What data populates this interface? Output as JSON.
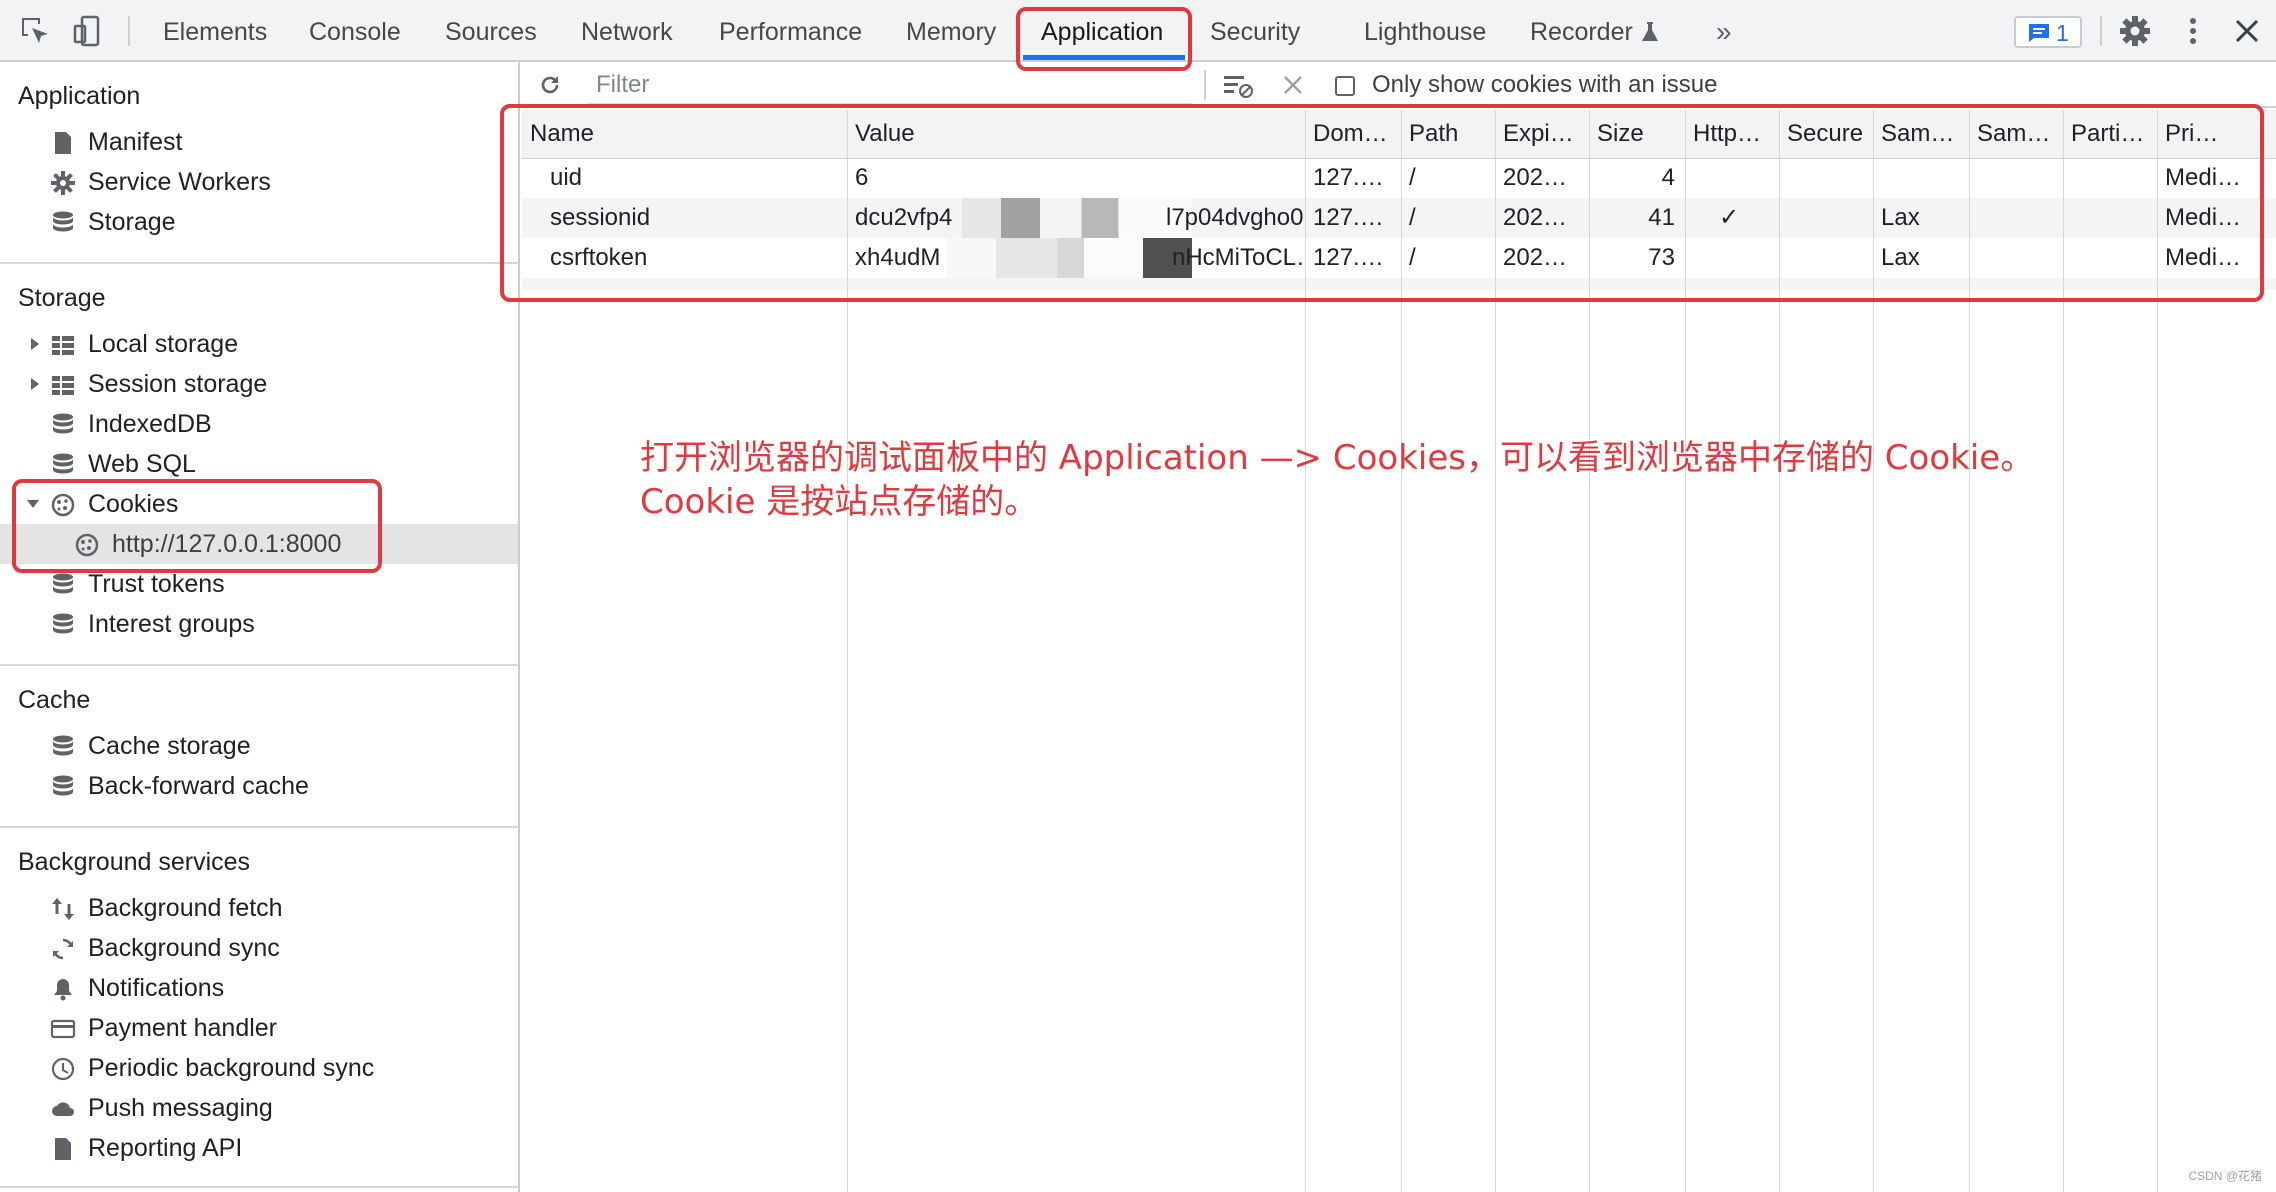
{
  "devtools": {
    "tabs": [
      "Elements",
      "Console",
      "Sources",
      "Network",
      "Performance",
      "Memory",
      "Application",
      "Security",
      "Lighthouse",
      "Recorder"
    ],
    "active_tab": "Application",
    "more_tabs_glyph": "»",
    "issues_count": "1",
    "icons": [
      "inspect-element-icon",
      "device-toolbar-icon",
      "recorder-flask-icon",
      "issues-message-icon",
      "settings-gear-icon",
      "more-vert-icon",
      "close-icon"
    ]
  },
  "sidebar": {
    "application": {
      "title": "Application",
      "items": [
        {
          "label": "Manifest",
          "icon": "document-icon"
        },
        {
          "label": "Service Workers",
          "icon": "gear-icon"
        },
        {
          "label": "Storage",
          "icon": "database-icon"
        }
      ]
    },
    "storage": {
      "title": "Storage",
      "items": [
        {
          "label": "Local storage",
          "icon": "table-grid-icon"
        },
        {
          "label": "Session storage",
          "icon": "table-grid-icon"
        },
        {
          "label": "IndexedDB",
          "icon": "database-icon"
        },
        {
          "label": "Web SQL",
          "icon": "database-icon"
        },
        {
          "label": "Cookies",
          "icon": "cookie-icon"
        },
        {
          "label": "http://127.0.0.1:8000",
          "icon": "cookie-icon"
        },
        {
          "label": "Trust tokens",
          "icon": "database-icon"
        },
        {
          "label": "Interest groups",
          "icon": "database-icon"
        }
      ]
    },
    "cache": {
      "title": "Cache",
      "items": [
        {
          "label": "Cache storage",
          "icon": "database-icon"
        },
        {
          "label": "Back-forward cache",
          "icon": "database-icon"
        }
      ]
    },
    "background": {
      "title": "Background services",
      "items": [
        {
          "label": "Background fetch",
          "icon": "up-down-arrows-icon"
        },
        {
          "label": "Background sync",
          "icon": "sync-icon"
        },
        {
          "label": "Notifications",
          "icon": "bell-icon"
        },
        {
          "label": "Payment handler",
          "icon": "card-icon"
        },
        {
          "label": "Periodic background sync",
          "icon": "clock-icon"
        },
        {
          "label": "Push messaging",
          "icon": "cloud-icon"
        },
        {
          "label": "Reporting API",
          "icon": "document-icon"
        }
      ]
    }
  },
  "toolbar": {
    "filter_placeholder": "Filter",
    "only_issues_label": "Only show cookies with an issue",
    "only_issues_checked": false
  },
  "table": {
    "columns": [
      "Name",
      "Value",
      "Dom…",
      "Path",
      "Expi…",
      "Size",
      "Http…",
      "Secure",
      "Sam…",
      "Sam…",
      "Parti…",
      "Pri…"
    ],
    "rows": [
      {
        "name": "uid",
        "value": "6",
        "domain": "127.…",
        "path": "/",
        "expires": "202…",
        "size": "4",
        "http": "",
        "secure": "",
        "samesite": "",
        "sameparty": "",
        "partition": "",
        "priority": "Medi…"
      },
      {
        "name": "sessionid",
        "value": "dcu2vfp4",
        "value_tail": "l7p04dvgho0",
        "domain": "127.…",
        "path": "/",
        "expires": "202…",
        "size": "41",
        "http": "✓",
        "secure": "",
        "samesite": "Lax",
        "sameparty": "",
        "partition": "",
        "priority": "Medi…"
      },
      {
        "name": "csrftoken",
        "value": "xh4udM",
        "value_tail": "nHcMiToCL…",
        "domain": "127.…",
        "path": "/",
        "expires": "202…",
        "size": "73",
        "http": "",
        "secure": "",
        "samesite": "Lax",
        "sameparty": "",
        "partition": "",
        "priority": "Medi…"
      }
    ]
  },
  "annotation": {
    "line1": "打开浏览器的调试面板中的 Application —> Cookies，可以看到浏览器中存储的 Cookie。",
    "line2": "Cookie 是按站点存储的。",
    "color": "#e0393e"
  },
  "watermark": "CSDN @花猪"
}
